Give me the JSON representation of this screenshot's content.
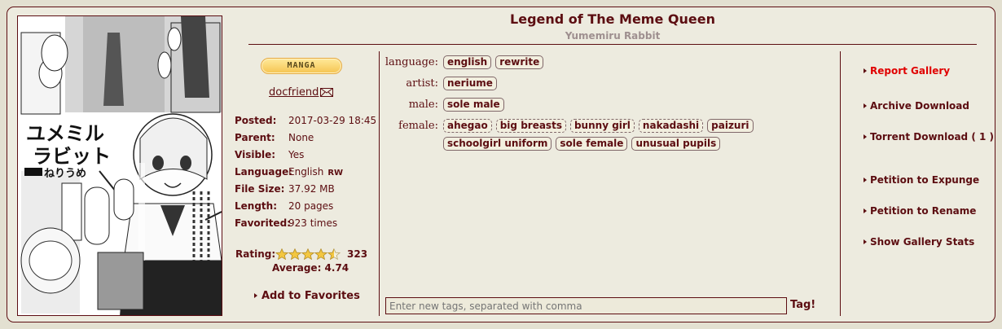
{
  "gallery": {
    "title": "Legend of The Meme Queen",
    "subtitle": "Yumemiru Rabbit"
  },
  "category": "MANGA",
  "uploader": "docfriend",
  "info": [
    {
      "key": "Posted:",
      "value": "2017-03-29 18:45"
    },
    {
      "key": "Parent:",
      "value": "None"
    },
    {
      "key": "Visible:",
      "value": "Yes"
    },
    {
      "key": "Language:",
      "value": "English",
      "badge": "RW"
    },
    {
      "key": "File Size:",
      "value": "37.92 MB"
    },
    {
      "key": "Length:",
      "value": "20 pages"
    },
    {
      "key": "Favorited:",
      "value": "923 times"
    }
  ],
  "rating": {
    "label": "Rating:",
    "count": "323",
    "average": "Average: 4.74",
    "stars_filled": 4.5
  },
  "add_favorites": "Add to Favorites",
  "tags": [
    {
      "ns": "language:",
      "items": [
        {
          "t": "english",
          "dashed": false
        },
        {
          "t": "rewrite",
          "dashed": false
        }
      ]
    },
    {
      "ns": "artist:",
      "items": [
        {
          "t": "neriume",
          "dashed": false
        }
      ]
    },
    {
      "ns": "male:",
      "items": [
        {
          "t": "sole male",
          "dashed": false
        }
      ]
    },
    {
      "ns": "female:",
      "items": [
        {
          "t": "ahegao",
          "dashed": true
        },
        {
          "t": "big breasts",
          "dashed": true
        },
        {
          "t": "bunny girl",
          "dashed": true
        },
        {
          "t": "nakadashi",
          "dashed": true
        },
        {
          "t": "paizuri",
          "dashed": false
        },
        {
          "t": "schoolgirl uniform",
          "dashed": false
        },
        {
          "t": "sole female",
          "dashed": false
        },
        {
          "t": "unusual pupils",
          "dashed": false
        }
      ]
    }
  ],
  "tag_input": {
    "placeholder": "Enter new tags, separated with comma",
    "button": "Tag!"
  },
  "actions": [
    {
      "label": "Report Gallery",
      "red": true
    },
    {
      "label": "Archive Download",
      "red": false
    },
    {
      "label": "Torrent Download ( 1 )",
      "red": false
    },
    {
      "label": "Petition to Expunge",
      "red": false
    },
    {
      "label": "Petition to Rename",
      "red": false
    },
    {
      "label": "Show Gallery Stats",
      "red": false
    }
  ],
  "colors": {
    "text": "#5c0d11",
    "report": "#e00000",
    "panel": "#edebdf",
    "background": "#e3e0d1"
  },
  "cover": {
    "title_text": "ユメミルラビット",
    "artist_text": "ねりうめ"
  }
}
